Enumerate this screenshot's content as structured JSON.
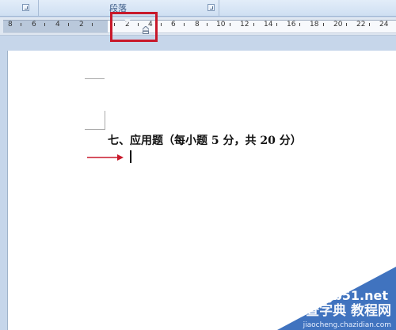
{
  "ribbon": {
    "group_label": "段落"
  },
  "ruler": {
    "labels": [
      "8",
      "6",
      "4",
      "2",
      "2",
      "4",
      "6",
      "8",
      "10",
      "12",
      "14",
      "16",
      "18",
      "20",
      "22",
      "24"
    ]
  },
  "document": {
    "heading": "七、应用题（每小题 5 分，共 20 分）"
  },
  "watermark": {
    "site": "jb51.net",
    "chinese": "查字典 教程网",
    "url": "jiaocheng.chazidian.com"
  },
  "colors": {
    "highlight_box": "#c8192b",
    "arrow": "#c8192b",
    "page": "#ffffff",
    "background": "#c6d6ea"
  }
}
